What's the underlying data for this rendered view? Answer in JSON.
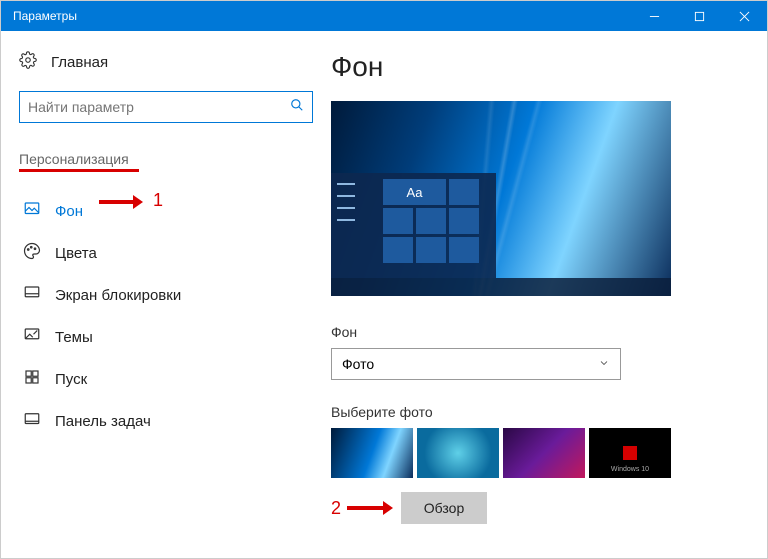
{
  "titlebar": {
    "title": "Параметры"
  },
  "sidebar": {
    "home_label": "Главная",
    "search_placeholder": "Найти параметр",
    "category": "Персонализация",
    "items": [
      {
        "label": "Фон"
      },
      {
        "label": "Цвета"
      },
      {
        "label": "Экран блокировки"
      },
      {
        "label": "Темы"
      },
      {
        "label": "Пуск"
      },
      {
        "label": "Панель задач"
      }
    ]
  },
  "main": {
    "heading": "Фон",
    "preview_sample_text": "Aa",
    "bg_label": "Фон",
    "bg_dropdown_value": "Фото",
    "choose_label": "Выберите фото",
    "browse_label": "Обзор",
    "thumb4_label": "Windows 10"
  },
  "annotations": {
    "a1": "1",
    "a2": "2"
  }
}
